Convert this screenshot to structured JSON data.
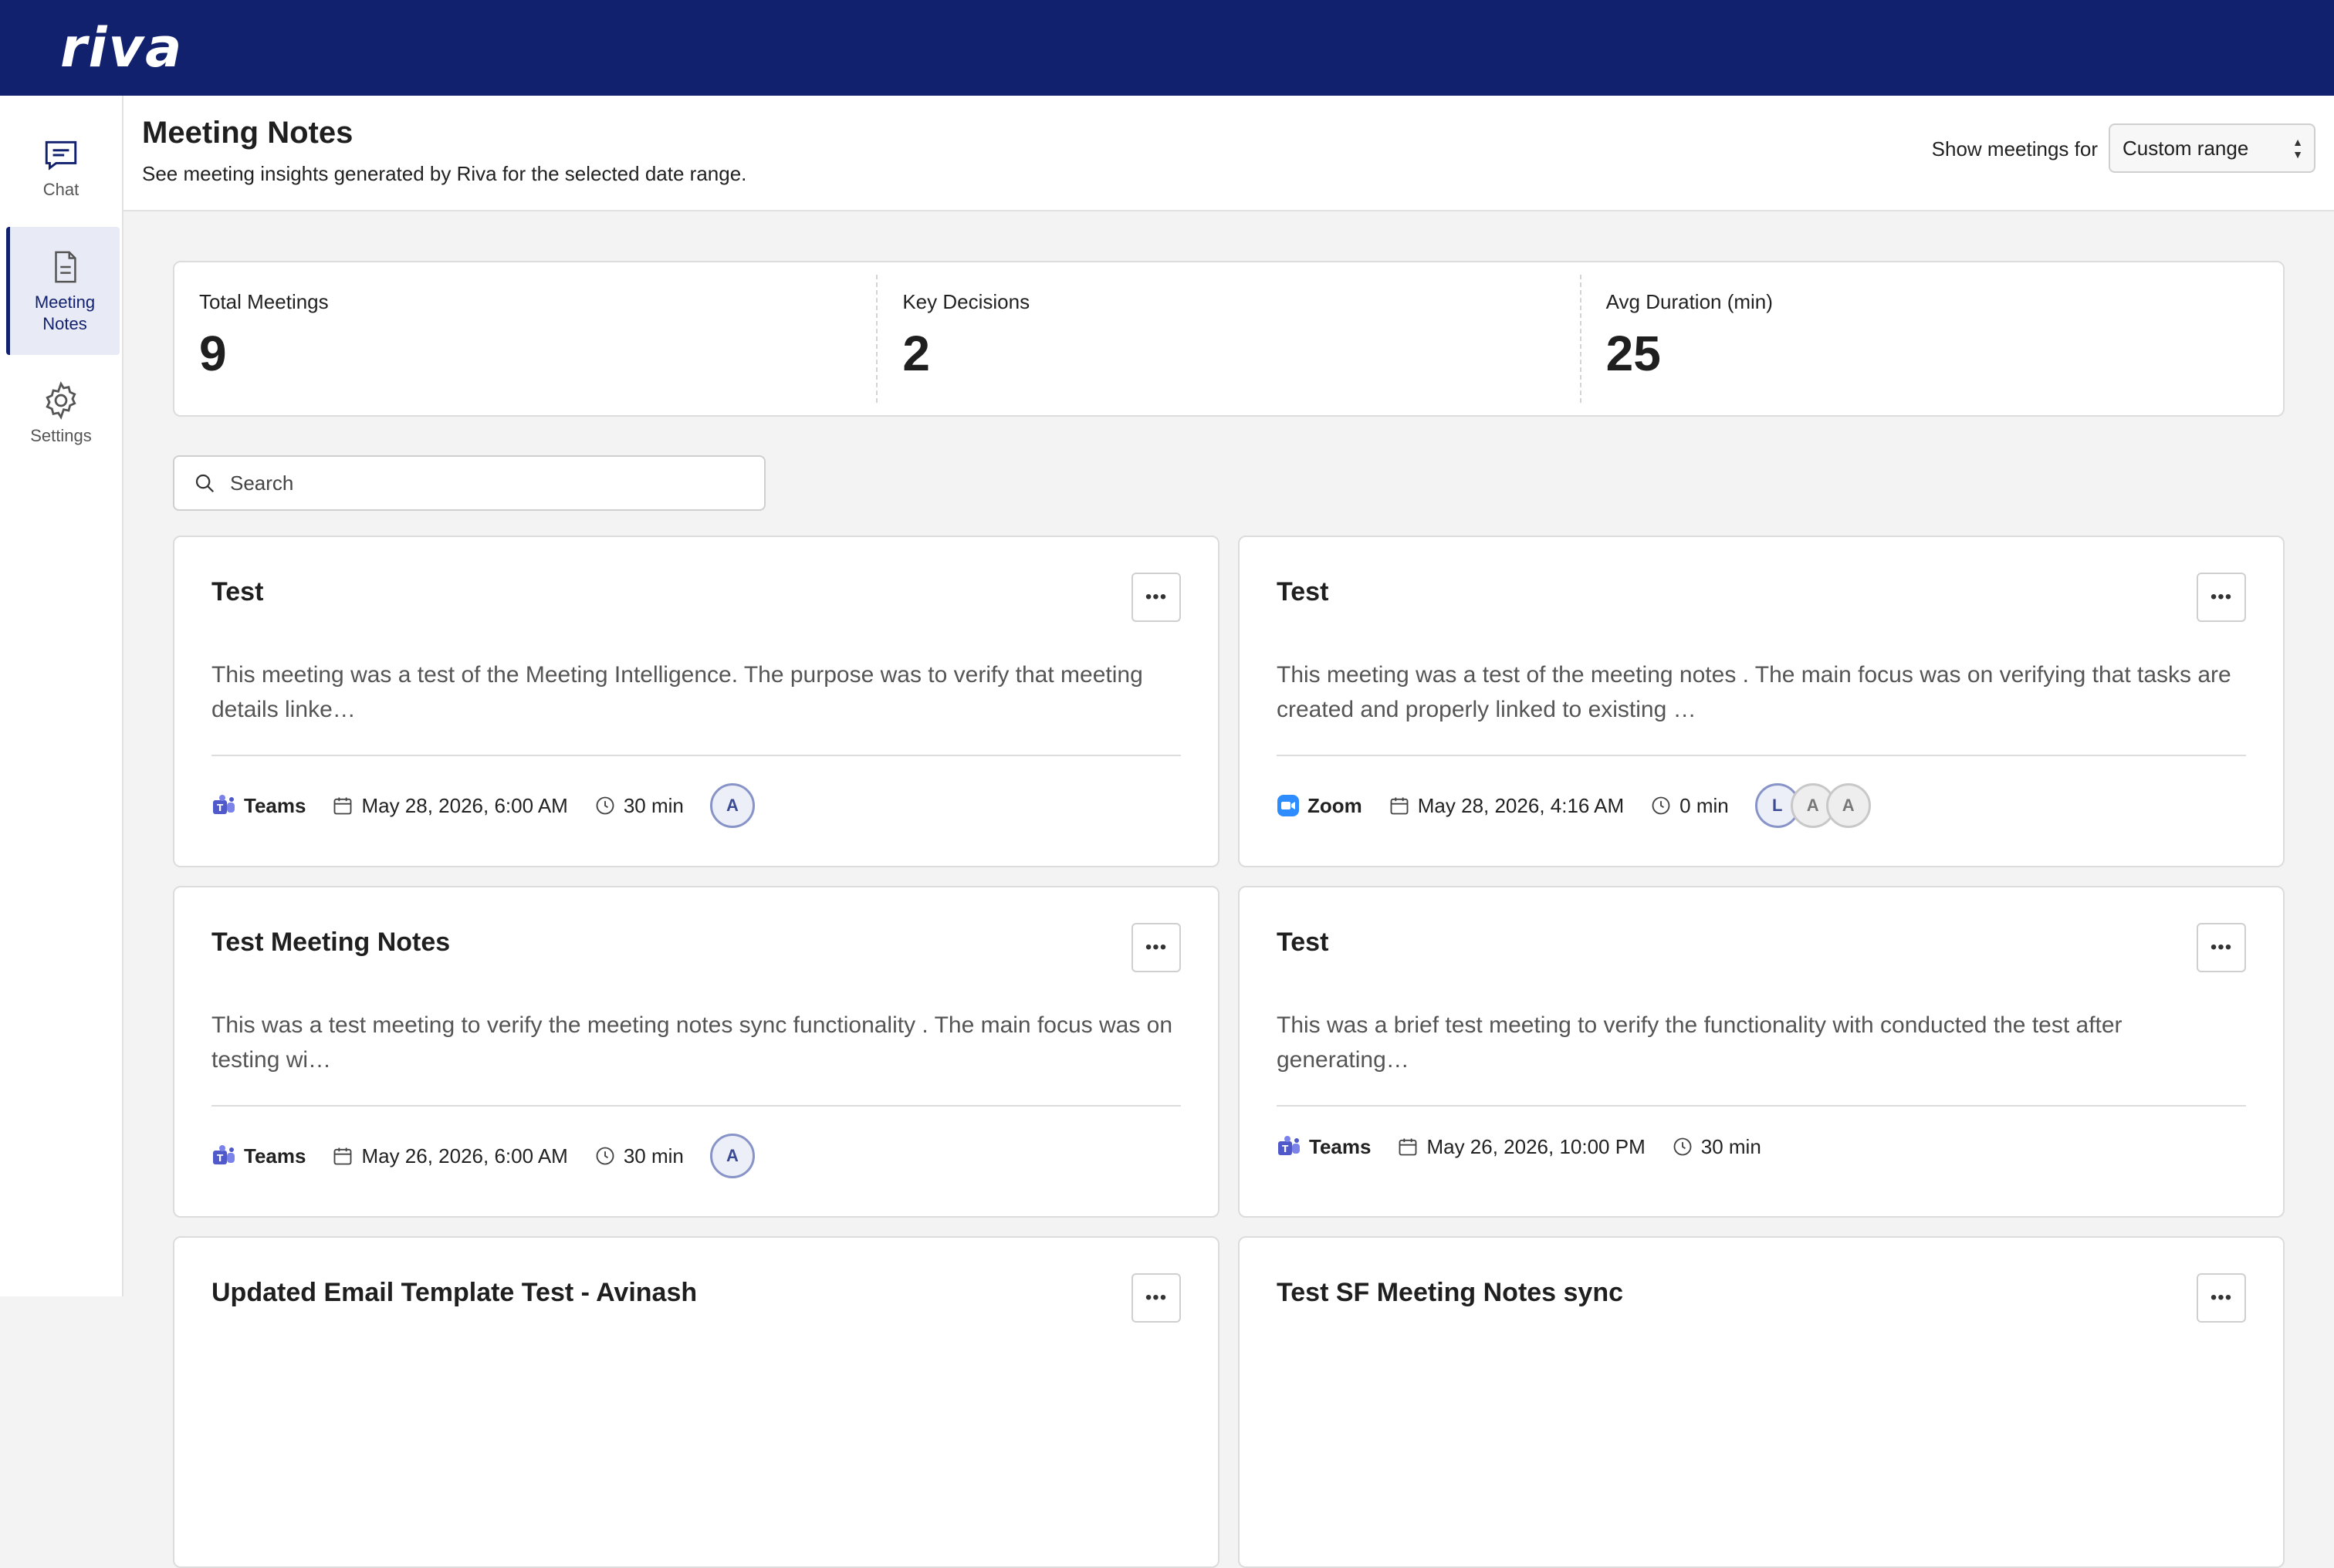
{
  "brand": {
    "logo": "riva",
    "primary": "#12216e"
  },
  "sidebar": {
    "items": [
      {
        "label": "Chat",
        "icon": "chat-icon",
        "active": false
      },
      {
        "label": "Meeting Notes",
        "icon": "document-icon",
        "active": true
      },
      {
        "label": "Settings",
        "icon": "gear-icon",
        "active": false
      }
    ]
  },
  "header": {
    "title": "Meeting Notes",
    "subtitle": "See meeting insights generated by Riva for the selected date range.",
    "range_label": "Show meetings for",
    "range_value": "Custom range"
  },
  "stats": [
    {
      "label": "Total Meetings",
      "value": "9"
    },
    {
      "label": "Key Decisions",
      "value": "2"
    },
    {
      "label": "Avg Duration (min)",
      "value": "25"
    }
  ],
  "search": {
    "placeholder": "Search"
  },
  "cards": [
    {
      "title": "Test",
      "description": "This meeting was a test of the Meeting Intelligence. The purpose was to verify that meeting details linke…",
      "platform": "Teams",
      "date": "May 28, 2026, 6:00 AM",
      "duration": "30 min",
      "attendees": [
        "A"
      ]
    },
    {
      "title": "Test",
      "description": "This meeting was a test of the meeting notes . The main focus was on verifying that tasks are created and properly linked to existing …",
      "platform": "Zoom",
      "date": "May 28, 2026, 4:16 AM",
      "duration": "0 min",
      "attendees": [
        "L",
        "A",
        "A"
      ]
    },
    {
      "title": "Test Meeting Notes",
      "description": "This was a test meeting to verify the meeting notes sync functionality . The main focus was on testing wi…",
      "platform": "Teams",
      "date": "May 26, 2026, 6:00 AM",
      "duration": "30 min",
      "attendees": [
        "A"
      ]
    },
    {
      "title": "Test",
      "description": "This was a brief test meeting to verify the functionality with conducted the test after generating…",
      "platform": "Teams",
      "date": "May 26, 2026, 10:00 PM",
      "duration": "30 min",
      "attendees": []
    },
    {
      "title": "Updated Email Template Test - Avinash",
      "description": "",
      "platform": "",
      "date": "",
      "duration": "",
      "attendees": []
    },
    {
      "title": "Test SF Meeting Notes sync",
      "description": "",
      "platform": "",
      "date": "",
      "duration": "",
      "attendees": []
    }
  ]
}
